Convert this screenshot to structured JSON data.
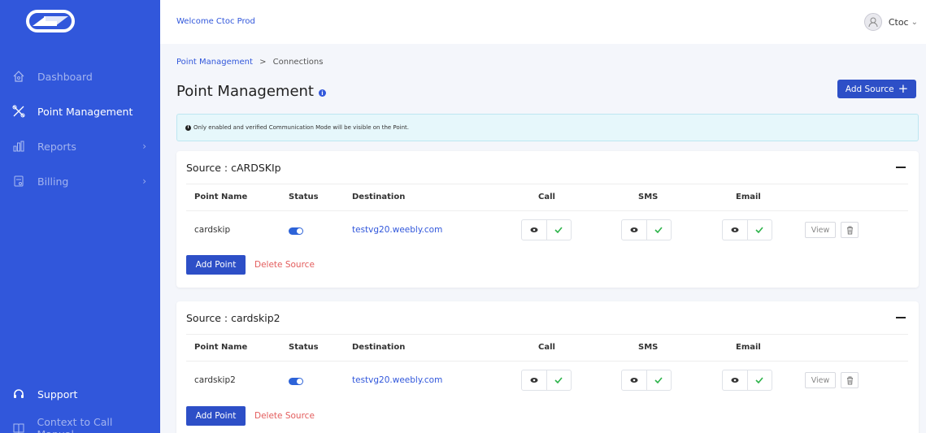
{
  "sidebar": {
    "items": [
      {
        "label": "Dashboard",
        "icon": "home-icon"
      },
      {
        "label": "Point Management",
        "icon": "tools-icon"
      },
      {
        "label": "Reports",
        "icon": "chart-icon"
      },
      {
        "label": "Billing",
        "icon": "billing-icon"
      }
    ],
    "bottom": [
      {
        "label": "Support",
        "icon": "headset-icon"
      },
      {
        "label": "Context to Call Manual",
        "icon": "book-icon"
      }
    ],
    "chevron": "›"
  },
  "topbar": {
    "welcome": "Welcome Ctoc Prod",
    "user_name": "Ctoc",
    "user_chevron": "⌄"
  },
  "breadcrumb": {
    "parent": "Point Management",
    "separator": ">",
    "current": "Connections"
  },
  "page": {
    "title": "Point Management",
    "info_glyph": "i",
    "add_source_label": "Add Source",
    "add_source_plus": "+"
  },
  "notice": {
    "glyph": "i",
    "text": "Only enabled and verified Communication Mode will be visible on the Point."
  },
  "table_headers": [
    "Point Name",
    "Status",
    "Destination",
    "Call",
    "SMS",
    "Email"
  ],
  "sources": [
    {
      "title": "Source : cARDSKIp",
      "row": {
        "point_name": "cardskip",
        "status": "enabled",
        "destination": "testvg20.weebly.com"
      },
      "view_label": "View",
      "add_point_label": "Add Point",
      "delete_source_label": "Delete Source"
    },
    {
      "title": "Source : cardskip2",
      "row": {
        "point_name": "cardskip2",
        "status": "enabled",
        "destination": "testvg20.weebly.com"
      },
      "view_label": "View",
      "add_point_label": "Add Point",
      "delete_source_label": "Delete Source"
    }
  ],
  "colors": {
    "sidebar": "#3157db",
    "primary_button": "#2d4fc7",
    "check": "#2db34a",
    "danger": "#e35d5d"
  }
}
